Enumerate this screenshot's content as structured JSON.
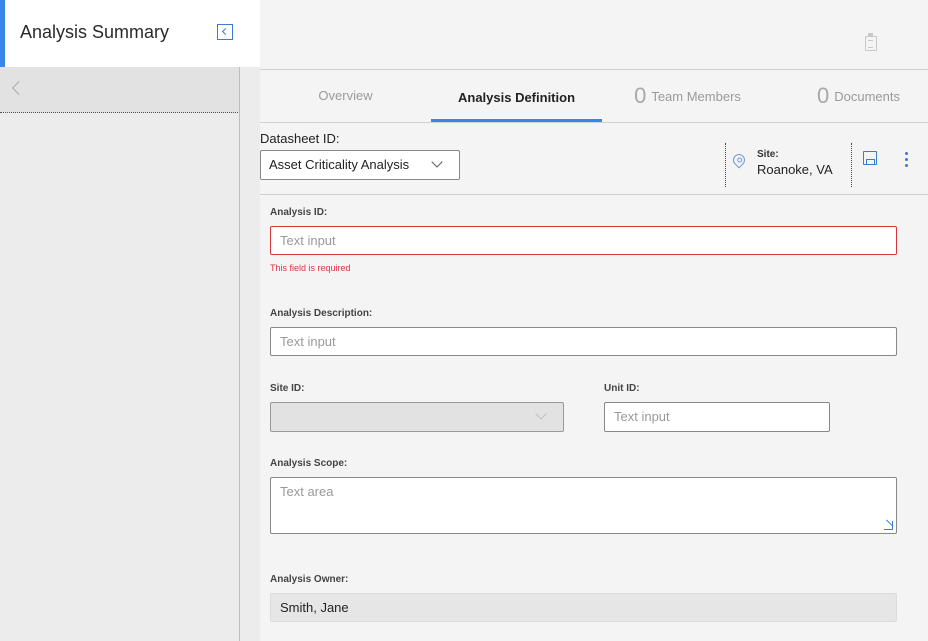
{
  "left_panel": {
    "title": "Analysis Summary"
  },
  "tabs": [
    {
      "label": "Overview",
      "count": null
    },
    {
      "label": "Analysis Definition",
      "count": null,
      "active": true
    },
    {
      "label": "Team Members",
      "count": "0"
    },
    {
      "label": "Documents",
      "count": "0"
    }
  ],
  "datasheet": {
    "label": "Datasheet ID:",
    "selected": "Asset Criticality Analysis"
  },
  "site": {
    "label": "Site:",
    "value": "Roanoke, VA"
  },
  "form": {
    "analysis_id": {
      "label": "Analysis ID:",
      "placeholder": "Text input",
      "error": "This field is required"
    },
    "analysis_description": {
      "label": "Analysis Description:",
      "placeholder": "Text input"
    },
    "site_id": {
      "label": "Site ID:",
      "value": ""
    },
    "unit_id": {
      "label": "Unit ID:",
      "placeholder": "Text input"
    },
    "analysis_scope": {
      "label": "Analysis Scope:",
      "placeholder": "Text area"
    },
    "analysis_owner": {
      "label": "Analysis Owner:",
      "value": "Smith, Jane"
    }
  },
  "colors": {
    "accent": "#3a86e8",
    "error": "#d9363e"
  },
  "icons": [
    "collapse-panel-icon",
    "back-arrow-icon",
    "clipboard-icon",
    "chevron-down-icon",
    "location-pin-icon",
    "save-icon",
    "more-vertical-icon",
    "resize-handle-icon"
  ]
}
